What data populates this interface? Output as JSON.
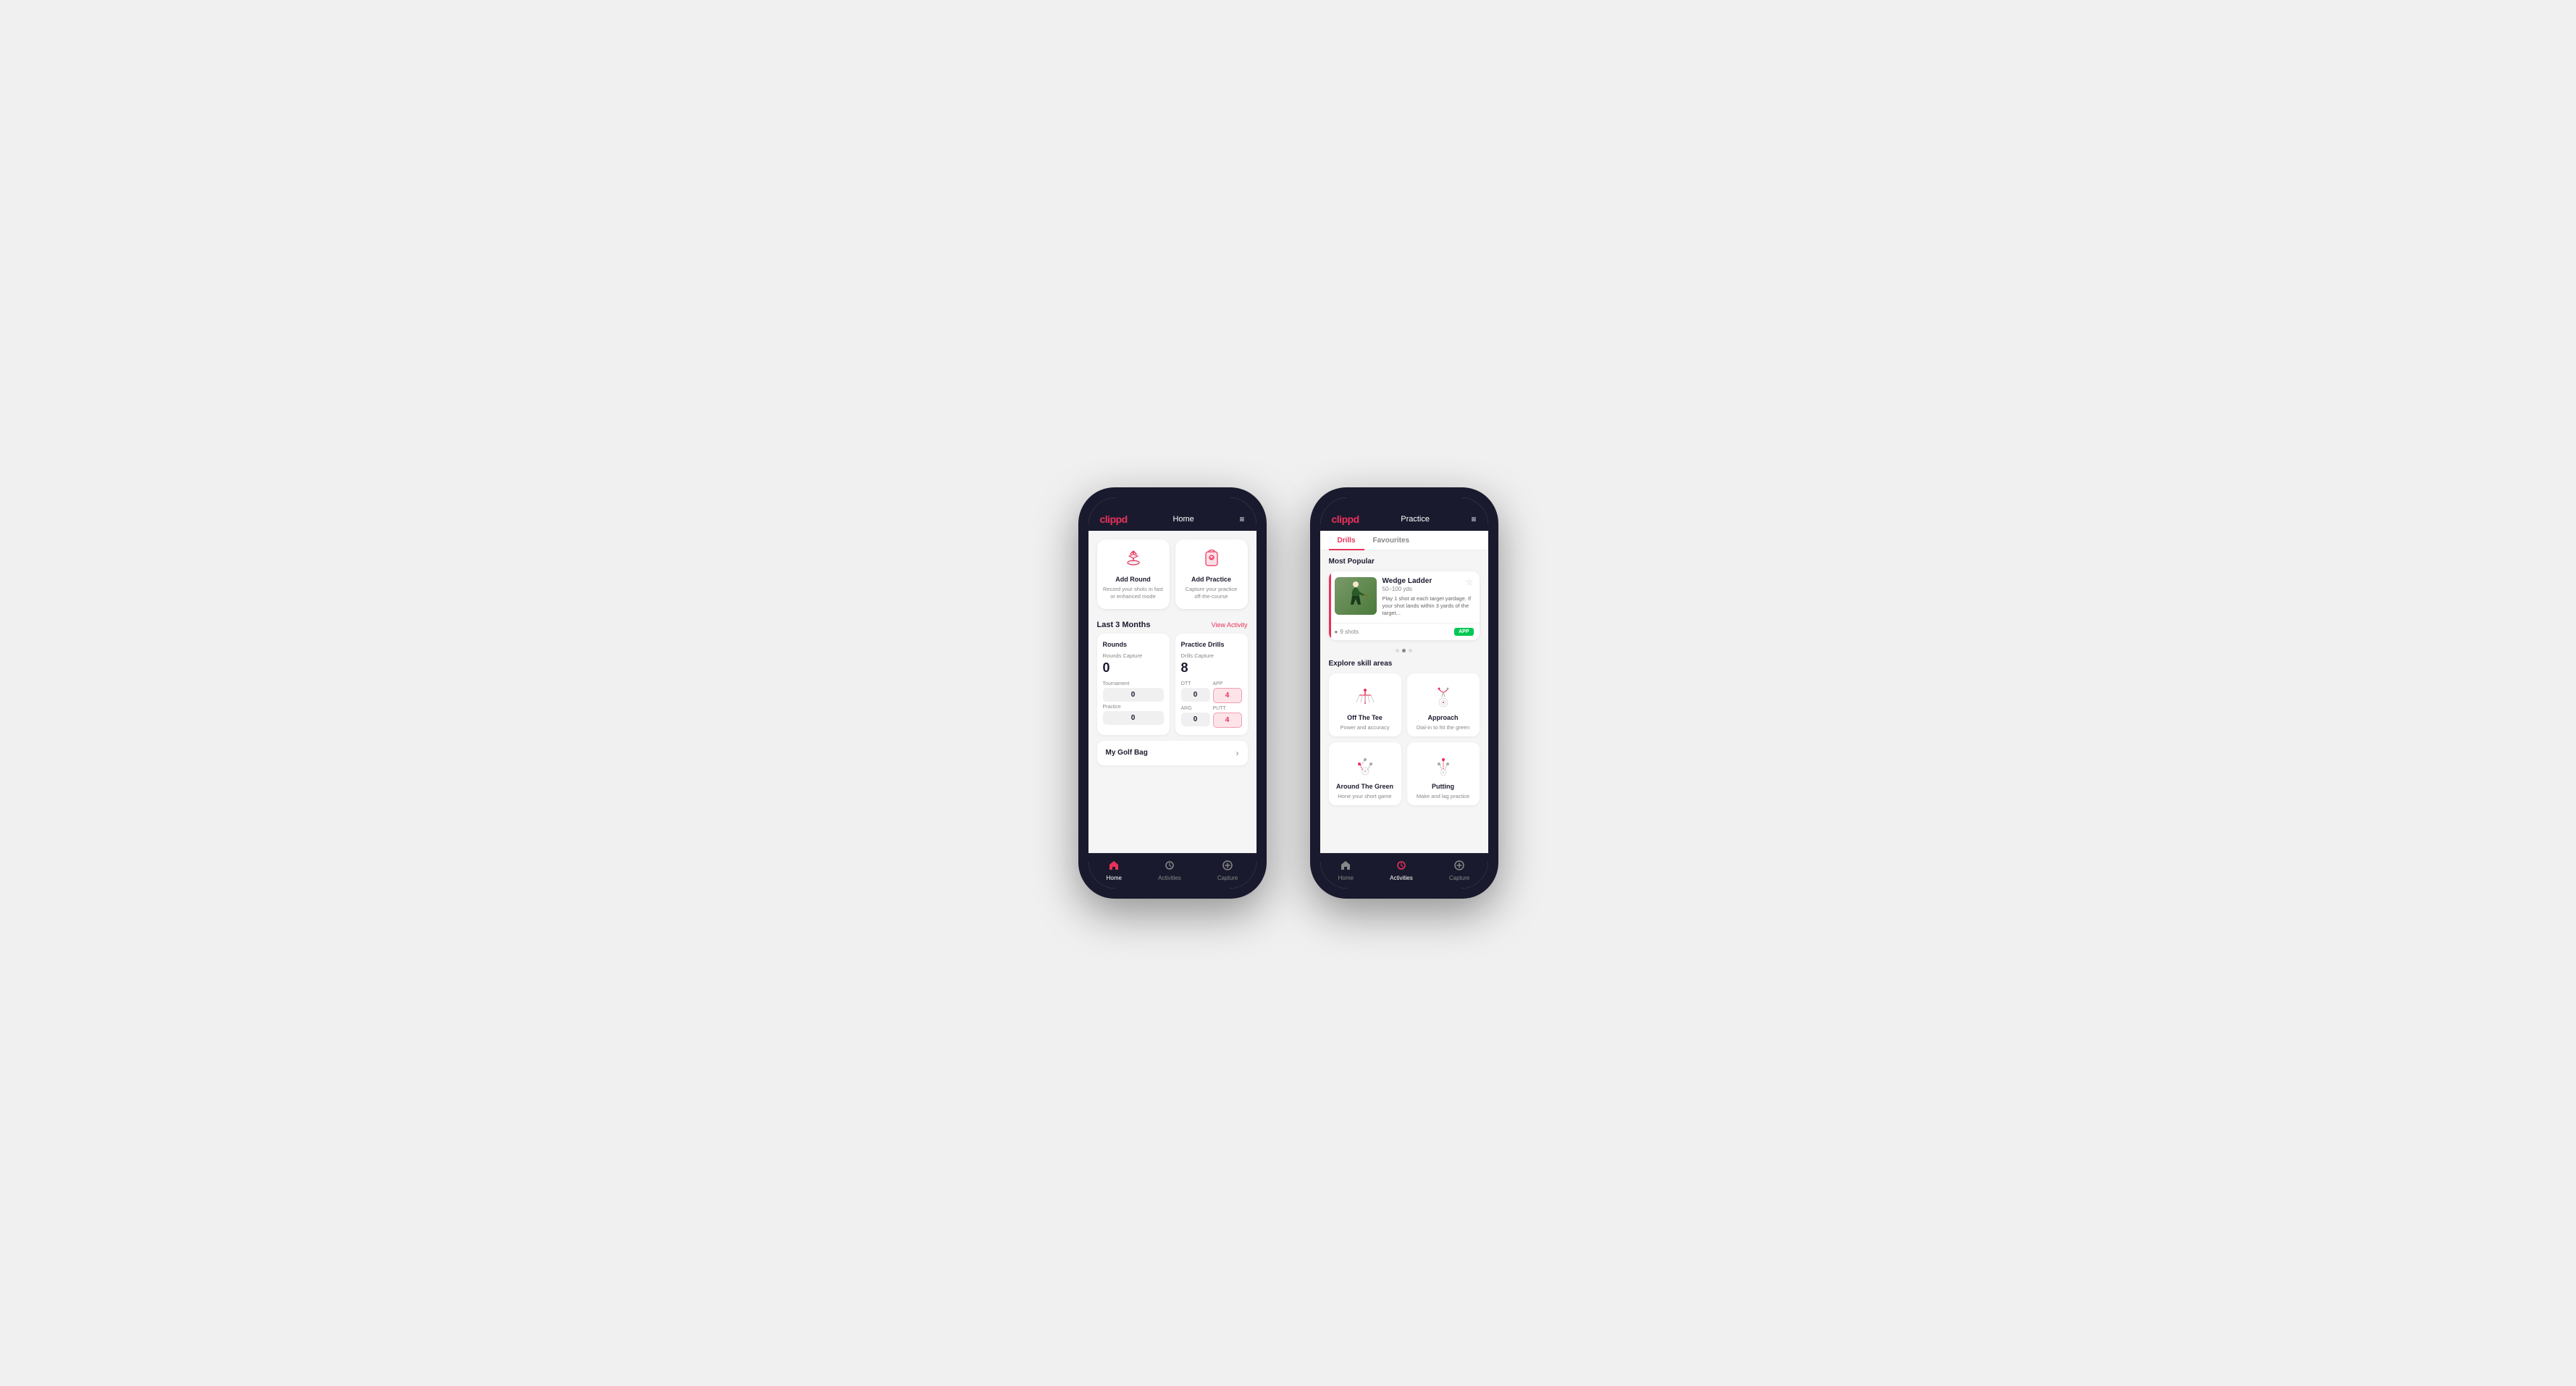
{
  "phone1": {
    "header": {
      "logo": "clippd",
      "title": "Home",
      "menu_icon": "≡"
    },
    "action_cards": [
      {
        "id": "add-round",
        "icon": "⛳",
        "title": "Add Round",
        "desc": "Record your shots in fast or enhanced mode"
      },
      {
        "id": "add-practice",
        "icon": "📋",
        "title": "Add Practice",
        "desc": "Capture your practice off-the-course"
      }
    ],
    "last3months": {
      "label": "Last 3 Months",
      "link": "View Activity"
    },
    "rounds": {
      "title": "Rounds",
      "capture_label": "Rounds Capture",
      "capture_value": "0",
      "tournament_label": "Tournament",
      "tournament_value": "0",
      "practice_label": "Practice",
      "practice_value": "0"
    },
    "practice_drills": {
      "title": "Practice Drills",
      "capture_label": "Drills Capture",
      "capture_value": "8",
      "ott_label": "OTT",
      "ott_value": "0",
      "app_label": "APP",
      "app_value": "4",
      "arg_label": "ARG",
      "arg_value": "0",
      "putt_label": "PUTT",
      "putt_value": "4"
    },
    "golf_bag": {
      "label": "My Golf Bag"
    },
    "nav": {
      "items": [
        {
          "id": "home",
          "icon": "🏠",
          "label": "Home",
          "active": true
        },
        {
          "id": "activities",
          "icon": "⛳",
          "label": "Activities",
          "active": false
        },
        {
          "id": "capture",
          "icon": "➕",
          "label": "Capture",
          "active": false
        }
      ]
    }
  },
  "phone2": {
    "header": {
      "logo": "clippd",
      "title": "Practice",
      "menu_icon": "≡"
    },
    "tabs": [
      {
        "id": "drills",
        "label": "Drills",
        "active": true
      },
      {
        "id": "favourites",
        "label": "Favourites",
        "active": false
      }
    ],
    "most_popular": {
      "label": "Most Popular",
      "drill": {
        "title": "Wedge Ladder",
        "yardage": "50–100 yds",
        "description": "Play 1 shot at each target yardage. If your shot lands within 3 yards of the target...",
        "shots_label": "9 shots",
        "badge": "APP",
        "star": "☆"
      }
    },
    "dots": [
      {
        "active": false
      },
      {
        "active": true
      },
      {
        "active": false
      }
    ],
    "explore": {
      "label": "Explore skill areas",
      "skills": [
        {
          "id": "off-the-tee",
          "name": "Off The Tee",
          "desc": "Power and accuracy"
        },
        {
          "id": "approach",
          "name": "Approach",
          "desc": "Dial-in to hit the green"
        },
        {
          "id": "around-the-green",
          "name": "Around The Green",
          "desc": "Hone your short game"
        },
        {
          "id": "putting",
          "name": "Putting",
          "desc": "Make and lag practice"
        }
      ]
    },
    "nav": {
      "items": [
        {
          "id": "home",
          "icon": "🏠",
          "label": "Home",
          "active": false
        },
        {
          "id": "activities",
          "icon": "⛳",
          "label": "Activities",
          "active": true
        },
        {
          "id": "capture",
          "icon": "➕",
          "label": "Capture",
          "active": false
        }
      ]
    }
  }
}
